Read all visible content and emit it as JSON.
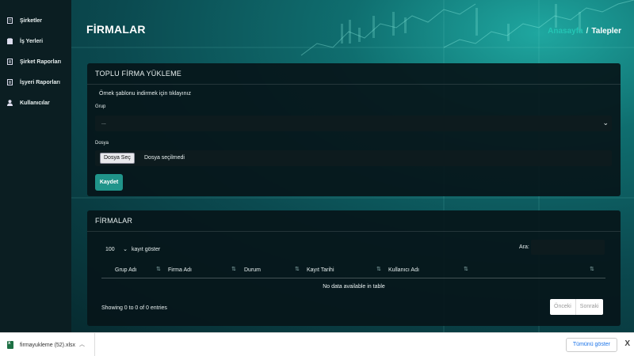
{
  "sidebar": {
    "items": [
      {
        "label": "Şirketler",
        "icon": "building-icon"
      },
      {
        "label": "İş Yerleri",
        "icon": "briefcase-icon"
      },
      {
        "label": "Şirket Raporları",
        "icon": "report-icon"
      },
      {
        "label": "İşyeri Raporları",
        "icon": "report-icon"
      },
      {
        "label": "Kullanıcılar",
        "icon": "user-icon"
      }
    ]
  },
  "header": {
    "title": "FİRMALAR",
    "breadcrumb": {
      "home": "Anasayfa",
      "separator": "/",
      "current": "Talepler"
    }
  },
  "upload_card": {
    "title": "TOPLU FİRMA YÜKLEME",
    "template_link": "Örnek şablonu indirmek için tıklayınız",
    "group_label": "Grup",
    "group_value": "...",
    "file_label": "Dosya",
    "file_button": "Dosya Seç",
    "file_status": "Dosya seçilmedi",
    "save_label": "Kaydet"
  },
  "list_card": {
    "title": "FİRMALAR",
    "page_length": "100",
    "page_length_suffix": "kayıt göster",
    "search_label": "Ara:",
    "search_value": "",
    "columns": [
      "Grup Adı",
      "Firma Adı",
      "Durum",
      "Kayıt Tarihi",
      "Kullanıcı Adı",
      ""
    ],
    "empty_message": "No data available in table",
    "info": "Showing 0 to 0 of 0 entries",
    "prev_label": "Önceki",
    "next_label": "Sonraki"
  },
  "download_bar": {
    "file_name": "firmayukleme (52).xlsx",
    "show_all": "Tümünü göster",
    "close": "X"
  },
  "colors": {
    "accent": "#20948a",
    "breadcrumb_home": "#24c4b4",
    "card_bg": "#06161a",
    "sidebar_bg": "#0b1e22"
  }
}
